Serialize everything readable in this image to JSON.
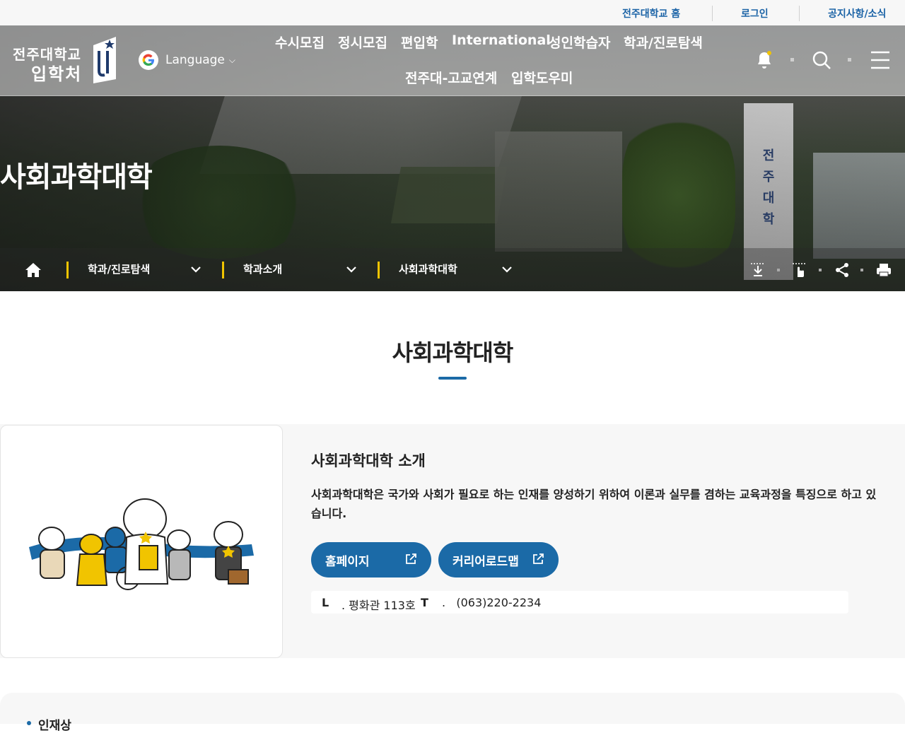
{
  "topbar": {
    "links": [
      "전주대학교 홈",
      "로그인",
      "공지사항/소식"
    ]
  },
  "header": {
    "logo_line1": "전주대학교",
    "logo_line2": "입학처",
    "language_label": "Language",
    "nav_row1": [
      "수시모집",
      "정시모집",
      "편입학",
      "International",
      "성인학습자",
      "학과/진로탐색"
    ],
    "nav_row2": [
      "전주대-고교연계",
      "입학도우미"
    ],
    "icons": [
      "bell-icon",
      "search-icon",
      "menu-icon"
    ]
  },
  "hero": {
    "title": "사회과학대학",
    "tower_text": [
      "전",
      "주",
      "대",
      "학"
    ]
  },
  "breadcrumb": {
    "items": [
      "학과/진로탐색",
      "학과소개",
      "사회과학대학"
    ],
    "tools": [
      "download-icon",
      "touch-icon",
      "share-icon",
      "print-icon"
    ]
  },
  "section": {
    "title": "사회과학대학"
  },
  "card": {
    "heading": "사회과학대학 소개",
    "description": "사회과학대학은 국가와 사회가 필요로 하는 인재를 양성하기 위하여 이론과 실무를 겸하는 교육과정을 특징으로 하고 있습니다.",
    "buttons": [
      "홈페이지",
      "커리어로드맵"
    ],
    "location_label": "L",
    "location_value": ". 평화관 113호",
    "tel_label": "T",
    "tel_value": ".   (063)220-2234"
  },
  "next_section": {
    "title": "인재상"
  },
  "colors": {
    "primary": "#1b6aa7",
    "link_blue": "#1b63a6",
    "accent_yellow": "#f1c400"
  }
}
